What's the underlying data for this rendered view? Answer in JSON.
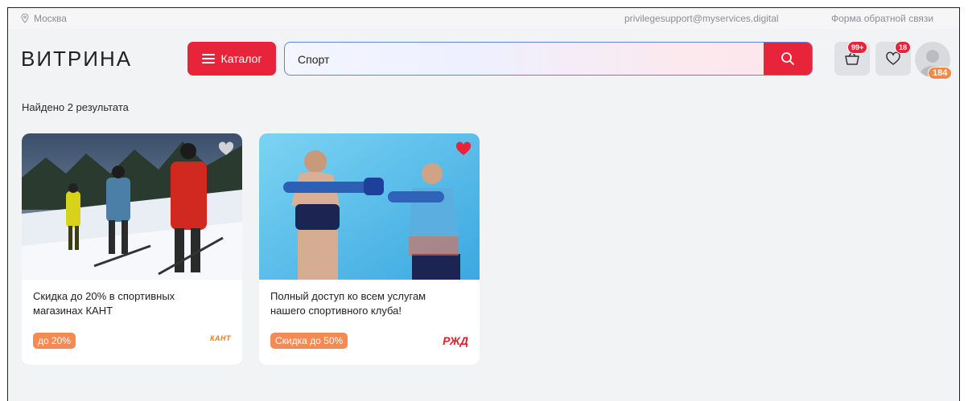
{
  "topbar": {
    "location": "Москва",
    "email": "privilegesupport@myservices.digital",
    "feedback": "Форма обратной связи"
  },
  "header": {
    "logo": "ВИТРИНА",
    "catalog_label": "Каталог",
    "search_value": "Спорт",
    "cart_badge": "99+",
    "favorites_badge": "18",
    "points": "184",
    "brand_color": "#e8243a"
  },
  "main": {
    "results_text": "Найдено 2 результата",
    "cards": [
      {
        "title": "Скидка до 20% в спортивных магазинах КАНТ",
        "promo": "до 20%",
        "partner": "КАНТ",
        "favorited": false
      },
      {
        "title": "Полный доступ ко всем услугам нашего спортивного клуба!",
        "promo": "Скидка до 50%",
        "partner": "РЖД",
        "favorited": true
      }
    ]
  }
}
